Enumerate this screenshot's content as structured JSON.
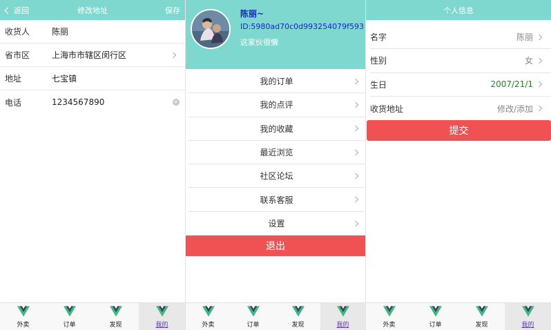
{
  "screen1": {
    "header": {
      "back_label": "返回",
      "title": "修改地址",
      "save_label": "保存"
    },
    "rows": [
      {
        "label": "收货人",
        "value": "陈丽"
      },
      {
        "label": "省市区",
        "value": "上海市市辖区闵行区"
      },
      {
        "label": "地址",
        "value": "七宝镇"
      },
      {
        "label": "电话",
        "value": "1234567890"
      }
    ]
  },
  "screen2": {
    "profile": {
      "name": "陈丽~",
      "id": "ID:5980ad70c0d993254079f593",
      "desc": "这家伙很懒"
    },
    "menu": [
      "我的订单",
      "我的点评",
      "我的收藏",
      "最近浏览",
      "社区论坛",
      "联系客服",
      "设置"
    ],
    "logout_label": "退出"
  },
  "screen3": {
    "header": {
      "title": "个人信息"
    },
    "rows": [
      {
        "label": "名字",
        "value": "陈丽"
      },
      {
        "label": "性别",
        "value": "女"
      },
      {
        "label": "生日",
        "value": "2007/21/1"
      },
      {
        "label": "收货地址",
        "value": "修改/添加"
      }
    ],
    "submit_label": "提交"
  },
  "tabbar": {
    "tabs": [
      "外卖",
      "订单",
      "发现",
      "我的"
    ],
    "active_index": 3
  },
  "colors": {
    "header": "#7fd8cf",
    "accent_red": "#f05152",
    "id_text": "#1426c8",
    "birthday": "#1a8c1a",
    "vue_green": "#41b883",
    "vue_dark": "#35495e"
  }
}
